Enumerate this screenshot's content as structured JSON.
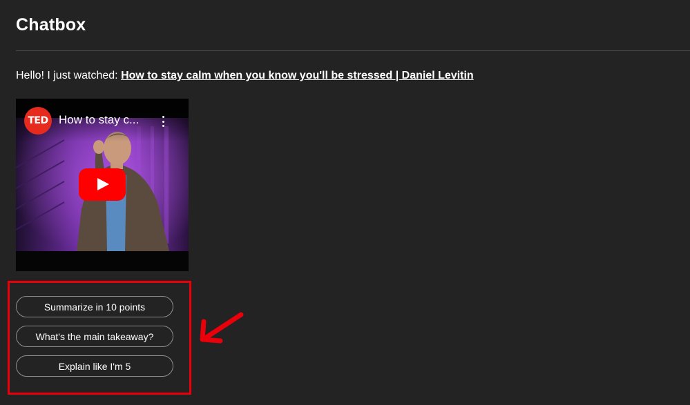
{
  "header": {
    "title": "Chatbox"
  },
  "message": {
    "prefix": "Hello! I just watched: ",
    "video_link_text": "How to stay calm when you know you'll be stressed | Daniel Levitin"
  },
  "video_embed": {
    "channel_badge": "TED",
    "title": "How to stay c...",
    "more_icon": "more-vert-icon",
    "play_icon": "play-icon"
  },
  "suggestions": [
    {
      "label": "Summarize in 10 points"
    },
    {
      "label": "What's the main takeaway?"
    },
    {
      "label": "Explain like I'm 5"
    }
  ],
  "annotation": {
    "color": "#e8000b",
    "arrow_icon": "arrow-icon"
  },
  "colors": {
    "background": "#232323",
    "text": "#ffffff",
    "play_button": "#ff0000",
    "ted_red": "#e62b1e"
  }
}
